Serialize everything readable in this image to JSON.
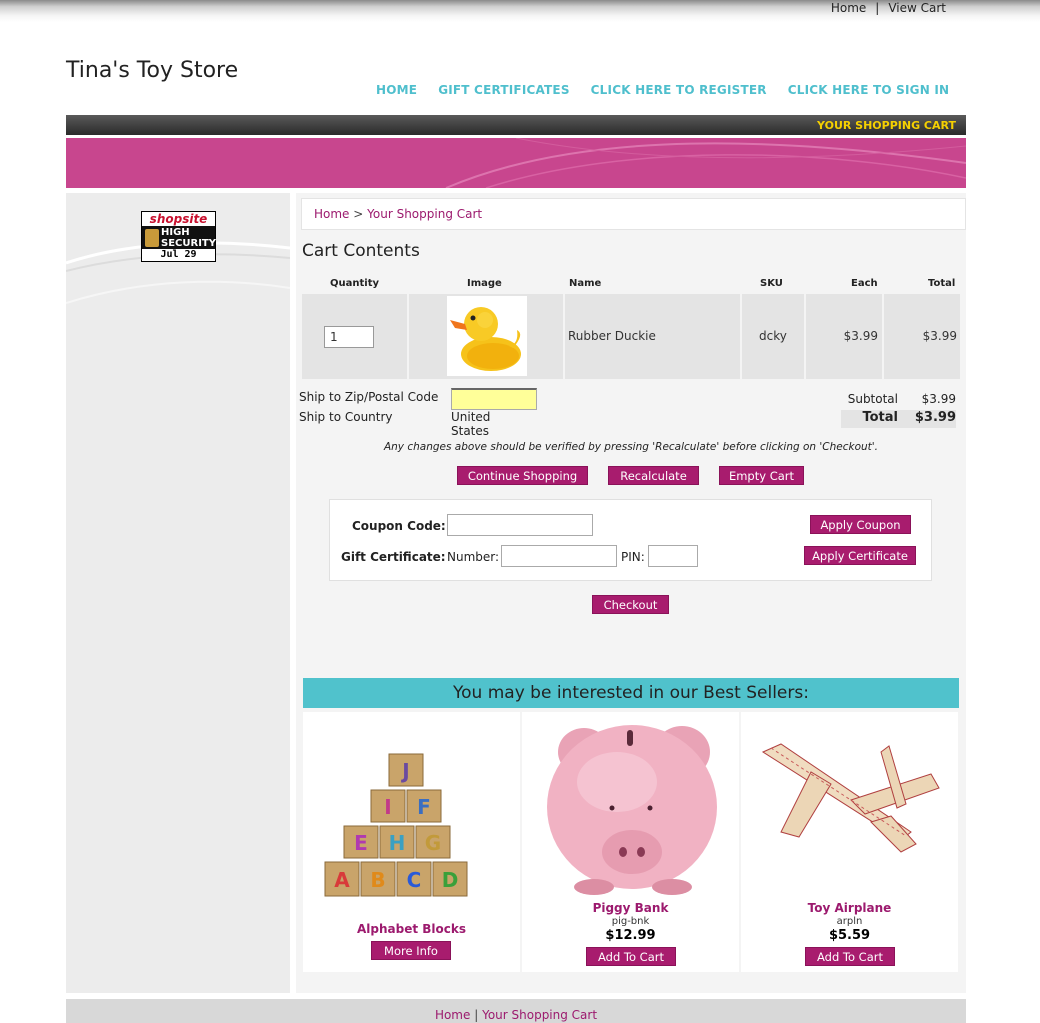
{
  "top_links": {
    "home": "Home",
    "sep": "|",
    "view_cart": "View Cart"
  },
  "store_title": "Tina's Toy Store",
  "nav": {
    "home": "HOME",
    "gift": "GIFT CERTIFICATES",
    "register": "CLICK HERE TO REGISTER",
    "signin": "CLICK HERE TO SIGN IN"
  },
  "dark_bar_label": "YOUR SHOPPING CART",
  "badge": {
    "brand": "shopsite",
    "line1": "HIGH",
    "line2": "SECURITY",
    "date": "Jul 29"
  },
  "breadcrumb": {
    "home": "Home",
    "sep": ">",
    "current": "Your Shopping Cart"
  },
  "cart_title": "Cart Contents",
  "table": {
    "headers": {
      "quantity": "Quantity",
      "image": "Image",
      "name": "Name",
      "sku": "SKU",
      "each": "Each",
      "total": "Total"
    },
    "rows": [
      {
        "quantity": "1",
        "name": "Rubber Duckie",
        "sku": "dcky",
        "each": "$3.99",
        "total": "$3.99"
      }
    ]
  },
  "shipping": {
    "zip_label": "Ship to Zip/Postal Code",
    "zip_value": "",
    "country_label": "Ship to Country",
    "country_value": "United States"
  },
  "totals": {
    "subtotal_label": "Subtotal",
    "subtotal": "$3.99",
    "total_label": "Total",
    "total": "$3.99"
  },
  "note": "Any changes above should be verified by pressing 'Recalculate' before clicking on 'Checkout'.",
  "buttons": {
    "continue": "Continue Shopping",
    "recalculate": "Recalculate",
    "empty": "Empty Cart",
    "checkout": "Checkout"
  },
  "coupon": {
    "coupon_label": "Coupon Code:",
    "apply_coupon": "Apply Coupon",
    "gift_label": "Gift Certificate:",
    "number_label": "Number:",
    "pin_label": "PIN:",
    "apply_certificate": "Apply Certificate"
  },
  "bestsellers": {
    "heading": "You may be interested in our Best Sellers:",
    "items": [
      {
        "name": "Alphabet Blocks",
        "button": "More Info"
      },
      {
        "name": "Piggy Bank",
        "sku": "pig-bnk",
        "price": "$12.99",
        "button": "Add To Cart"
      },
      {
        "name": "Toy Airplane",
        "sku": "arpln",
        "price": "$5.59",
        "button": "Add To Cart"
      }
    ]
  },
  "footer": {
    "home": "Home",
    "sep": "|",
    "cart": "Your Shopping Cart"
  },
  "colors": {
    "brand_pink": "#c8468e",
    "button": "#a81c6e",
    "link": "#9c1a6e",
    "teal": "#50c2cc",
    "nav": "#4fbfcd",
    "cart_label": "#f5d000",
    "zip_field": "#ffff99"
  }
}
